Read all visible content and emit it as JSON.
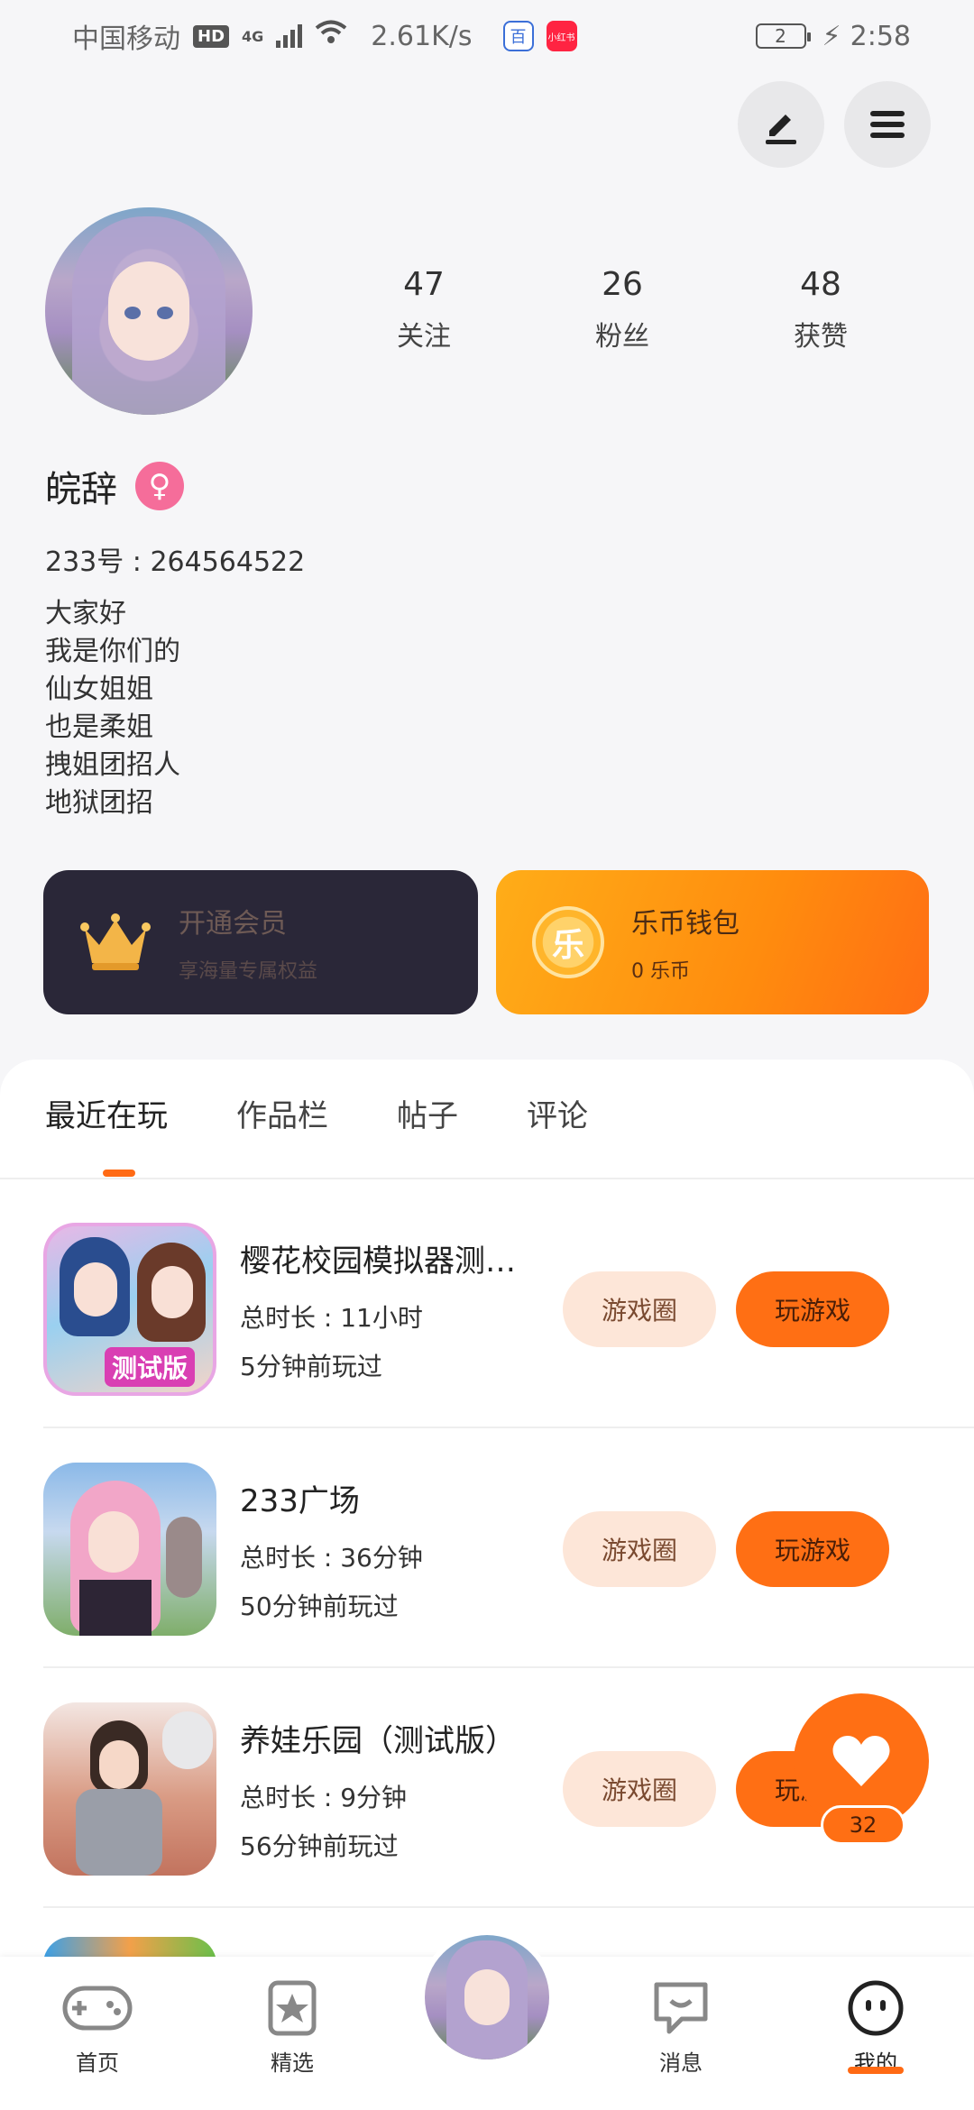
{
  "status_bar": {
    "carrier": "中国移动",
    "hd": "HD",
    "network": "4G",
    "speed": "2.61K/s",
    "battery": "2",
    "time": "2:58",
    "app_badge_red": "小红书"
  },
  "profile": {
    "stats": [
      {
        "num": "47",
        "label": "关注"
      },
      {
        "num": "26",
        "label": "粉丝"
      },
      {
        "num": "48",
        "label": "获赞"
      }
    ],
    "name": "皖辞",
    "gender_symbol": "♀",
    "uid": "233号 : 264564522",
    "bio": [
      "大家好",
      "我是你们的",
      "仙女姐姐",
      "也是柔姐",
      "拽姐团招人",
      "地狱团招"
    ]
  },
  "cards": {
    "vip": {
      "title": "开通会员",
      "subtitle": "享海量专属权益"
    },
    "wallet": {
      "coin_glyph": "乐",
      "title": "乐币钱包",
      "subtitle": "0 乐币"
    }
  },
  "tabs": [
    "最近在玩",
    "作品栏",
    "帖子",
    "评论"
  ],
  "games": [
    {
      "title": "樱花校园模拟器测…",
      "duration": "总时长 : 11小时",
      "last_played": "5分钟前玩过",
      "icon_badge": "测试版"
    },
    {
      "title": "233广场",
      "duration": "总时长 : 36分钟",
      "last_played": "50分钟前玩过"
    },
    {
      "title": "养娃乐园（测试版）",
      "duration": "总时长 : 9分钟",
      "last_played": "56分钟前玩过"
    }
  ],
  "buttons": {
    "circle": "游戏圈",
    "play": "玩游戏"
  },
  "like_count": "32",
  "bottom_nav": [
    {
      "label": "首页",
      "icon": "gamepad-icon"
    },
    {
      "label": "精选",
      "icon": "star-icon"
    },
    {
      "label": "消息",
      "icon": "chat-icon"
    },
    {
      "label": "我的",
      "icon": "face-icon"
    }
  ],
  "colors": {
    "accent": "#ff6f14",
    "vip_bg": "#2a2738",
    "gender": "#f56d9a"
  }
}
